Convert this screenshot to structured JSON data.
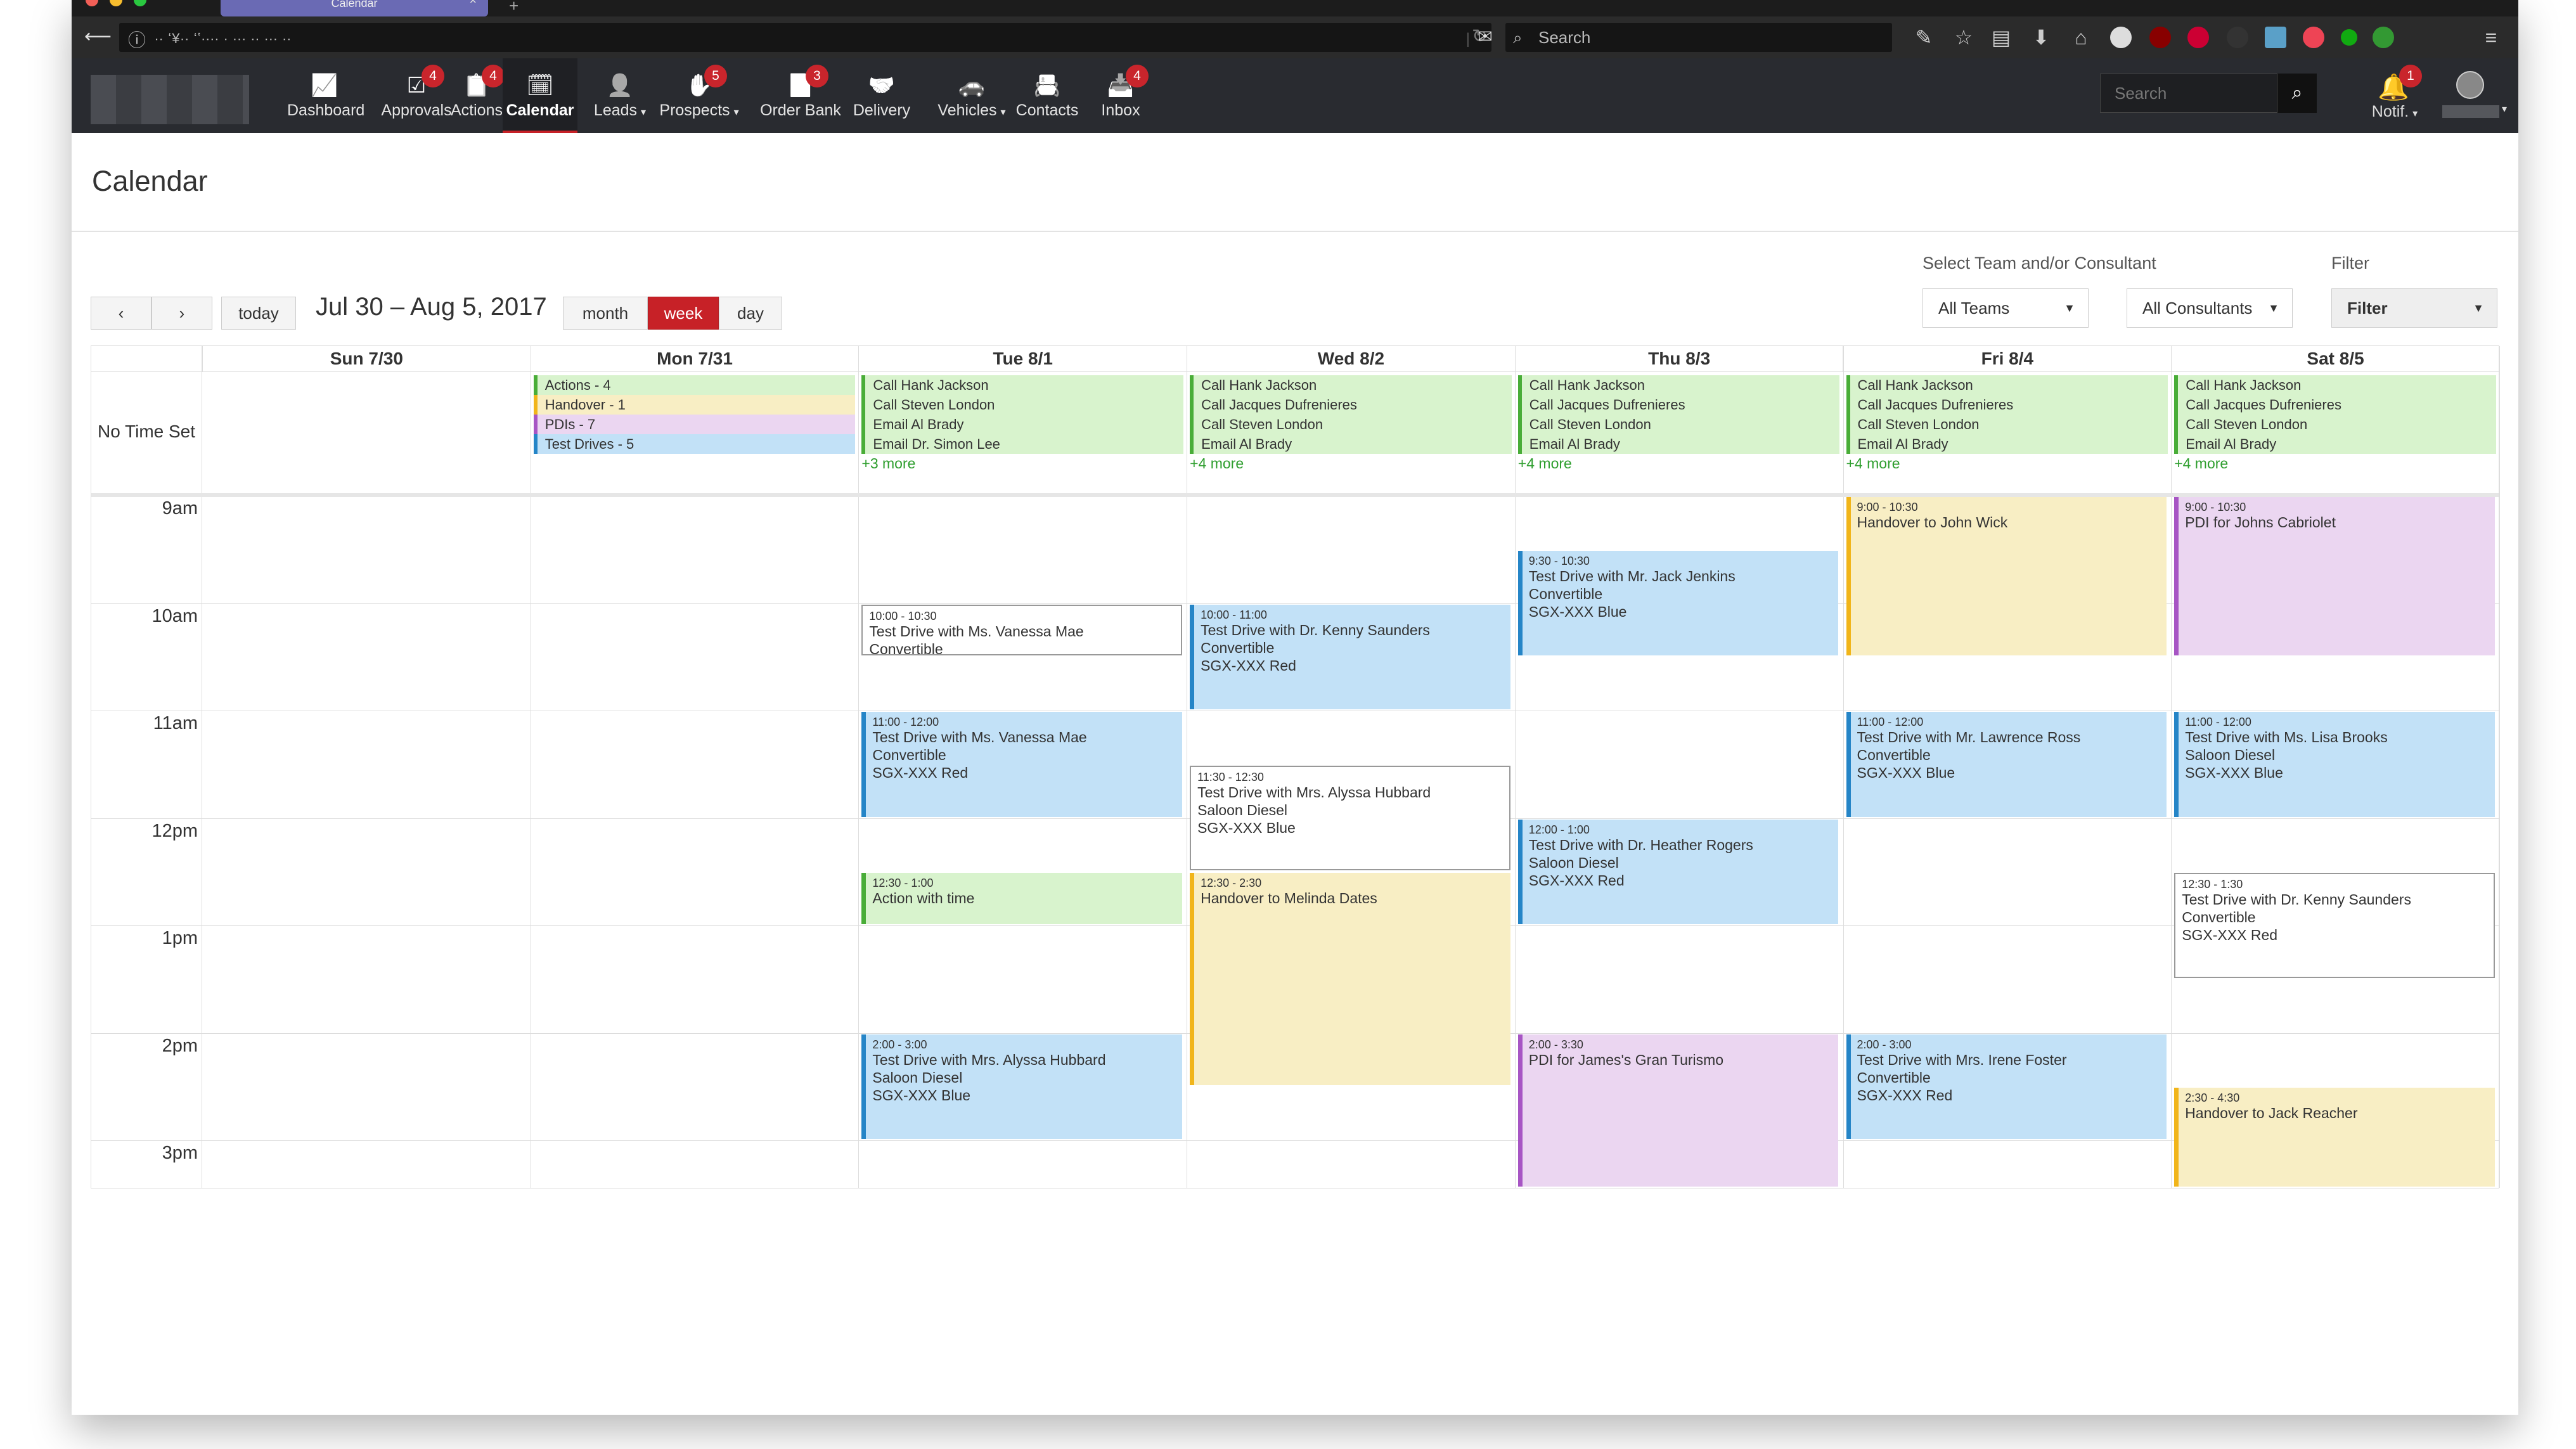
{
  "browser": {
    "tab_title": "Calendar",
    "url": "∙∙ ʻ¥∙∙ ʻʽ∙∙∙∙ ∙ ∙∙∙ ∙∙ ∙∙∙ ∙∙",
    "search_placeholder": "Search"
  },
  "nav": {
    "items": [
      {
        "label": "Dashboard",
        "icon": "chart-icon",
        "badge": ""
      },
      {
        "label": "Approvals",
        "icon": "checkbox-icon",
        "badge": "4"
      },
      {
        "label": "Actions",
        "icon": "clipboard-icon",
        "badge": "4"
      },
      {
        "label": "Calendar",
        "icon": "calendar-icon",
        "badge": ""
      },
      {
        "label": "Leads",
        "icon": "person-icon",
        "badge": ""
      },
      {
        "label": "Prospects",
        "icon": "hand-icon",
        "badge": "5"
      },
      {
        "label": "Order Bank",
        "icon": "document-icon",
        "badge": "3"
      },
      {
        "label": "Delivery",
        "icon": "handshake-icon",
        "badge": ""
      },
      {
        "label": "Vehicles",
        "icon": "car-icon",
        "badge": ""
      },
      {
        "label": "Contacts",
        "icon": "contacts-icon",
        "badge": ""
      },
      {
        "label": "Inbox",
        "icon": "inbox-icon",
        "badge": "4"
      }
    ],
    "search_placeholder": "Search",
    "notif_label": "Notif.",
    "notif_badge": "1"
  },
  "page": {
    "title": "Calendar"
  },
  "toolbar": {
    "today": "today",
    "range": "Jul 30 – Aug 5, 2017",
    "view_month": "month",
    "view_week": "week",
    "view_day": "day",
    "active_view": "week",
    "team_label": "Select Team and/or Consultant",
    "team_value": "All Teams",
    "consultant_value": "All Consultants",
    "filter_label": "Filter",
    "filter_value": "Filter"
  },
  "calendar": {
    "days": [
      "Sun 7/30",
      "Mon 7/31",
      "Tue 8/1",
      "Wed 8/2",
      "Thu 8/3",
      "Fri 8/4",
      "Sat 8/5"
    ],
    "no_time_label": "No Time Set",
    "times": [
      "9am",
      "10am",
      "11am",
      "12pm",
      "1pm",
      "2pm",
      "3pm"
    ],
    "allday": {
      "Mon 7/31": [
        {
          "text": "Actions - 4",
          "color": "#d8f3cd",
          "accent": "#49ad38"
        },
        {
          "text": "Handover - 1",
          "color": "#f8eec4",
          "accent": "#f1b51a"
        },
        {
          "text": "PDIs - 7",
          "color": "#ebd6f1",
          "accent": "#a755c4"
        },
        {
          "text": "Test Drives - 5",
          "color": "#c2e1f7",
          "accent": "#2585c7"
        }
      ],
      "Tue 8/1": {
        "items": [
          "Call Hank Jackson",
          "Call Steven London",
          "Email Al Brady",
          "Email Dr. Simon Lee"
        ],
        "more": "+3 more"
      },
      "Wed 8/2": {
        "items": [
          "Call Hank Jackson",
          "Call Jacques Dufrenieres",
          "Call Steven London",
          "Email Al Brady"
        ],
        "more": "+4 more"
      },
      "Thu 8/3": {
        "items": [
          "Call Hank Jackson",
          "Call Jacques Dufrenieres",
          "Call Steven London",
          "Email Al Brady"
        ],
        "more": "+4 more"
      },
      "Fri 8/4": {
        "items": [
          "Call Hank Jackson",
          "Call Jacques Dufrenieres",
          "Call Steven London",
          "Email Al Brady"
        ],
        "more": "+4 more"
      },
      "Sat 8/5": {
        "items": [
          "Call Hank Jackson",
          "Call Jacques Dufrenieres",
          "Call Steven London",
          "Email Al Brady"
        ],
        "more": "+4 more"
      }
    },
    "events": [
      {
        "day": 2,
        "start": 10.0,
        "end": 10.5,
        "style": "wht",
        "time": "10:00 - 10:30",
        "lines": [
          "Test Drive with Ms. Vanessa Mae",
          "Convertible"
        ]
      },
      {
        "day": 2,
        "start": 11.0,
        "end": 12.0,
        "style": "blue",
        "time": "11:00 - 12:00",
        "lines": [
          "Test Drive with Ms. Vanessa Mae",
          "Convertible",
          "SGX-XXX Red"
        ]
      },
      {
        "day": 2,
        "start": 12.5,
        "end": 13.0,
        "style": "grn",
        "time": "12:30 - 1:00",
        "lines": [
          "Action with time"
        ]
      },
      {
        "day": 2,
        "start": 14.0,
        "end": 15.0,
        "style": "blue",
        "time": "2:00 - 3:00",
        "lines": [
          "Test Drive with Mrs. Alyssa Hubbard",
          "Saloon Diesel",
          "SGX-XXX Blue"
        ]
      },
      {
        "day": 3,
        "start": 10.0,
        "end": 11.0,
        "style": "blue",
        "time": "10:00 - 11:00",
        "lines": [
          "Test Drive with Dr. Kenny Saunders",
          "Convertible",
          "SGX-XXX Red"
        ]
      },
      {
        "day": 3,
        "start": 11.5,
        "end": 12.5,
        "style": "wht",
        "time": "11:30 - 12:30",
        "lines": [
          "Test Drive with Mrs. Alyssa Hubbard",
          "Saloon Diesel",
          "SGX-XXX Blue"
        ]
      },
      {
        "day": 3,
        "start": 12.5,
        "end": 14.5,
        "style": "yel",
        "time": "12:30 - 2:30",
        "lines": [
          "Handover to Melinda Dates"
        ]
      },
      {
        "day": 4,
        "start": 9.5,
        "end": 10.5,
        "style": "blue",
        "time": "9:30 - 10:30",
        "lines": [
          "Test Drive with Mr. Jack Jenkins",
          "Convertible",
          "SGX-XXX Blue"
        ]
      },
      {
        "day": 4,
        "start": 12.0,
        "end": 13.0,
        "style": "blue",
        "time": "12:00 - 1:00",
        "lines": [
          "Test Drive with Dr. Heather Rogers",
          "Saloon Diesel",
          "SGX-XXX Red"
        ]
      },
      {
        "day": 4,
        "start": 14.0,
        "end": 15.5,
        "style": "pur",
        "time": "2:00 - 3:30",
        "lines": [
          "PDI for James's Gran Turismo"
        ]
      },
      {
        "day": 5,
        "start": 9.0,
        "end": 10.5,
        "style": "yel",
        "time": "9:00 - 10:30",
        "lines": [
          "Handover to John Wick"
        ]
      },
      {
        "day": 5,
        "start": 11.0,
        "end": 12.0,
        "style": "blue",
        "time": "11:00 - 12:00",
        "lines": [
          "Test Drive with Mr. Lawrence Ross",
          "Convertible",
          "SGX-XXX Blue"
        ]
      },
      {
        "day": 5,
        "start": 14.0,
        "end": 15.0,
        "style": "blue",
        "time": "2:00 - 3:00",
        "lines": [
          "Test Drive with Mrs. Irene Foster",
          "Convertible",
          "SGX-XXX Red"
        ]
      },
      {
        "day": 6,
        "start": 9.0,
        "end": 10.5,
        "style": "pur",
        "time": "9:00 - 10:30",
        "lines": [
          "PDI for Johns Cabriolet"
        ]
      },
      {
        "day": 6,
        "start": 11.0,
        "end": 12.0,
        "style": "blue",
        "time": "11:00 - 12:00",
        "lines": [
          "Test Drive with Ms. Lisa Brooks",
          "Saloon Diesel",
          "SGX-XXX Blue"
        ]
      },
      {
        "day": 6,
        "start": 12.5,
        "end": 13.5,
        "style": "wht",
        "time": "12:30 - 1:30",
        "lines": [
          "Test Drive with Dr. Kenny Saunders",
          "Convertible",
          "SGX-XXX Red"
        ]
      },
      {
        "day": 6,
        "start": 14.5,
        "end": 15.5,
        "style": "yel",
        "time": "2:30 - 4:30",
        "lines": [
          "Handover to Jack Reacher"
        ]
      }
    ]
  }
}
